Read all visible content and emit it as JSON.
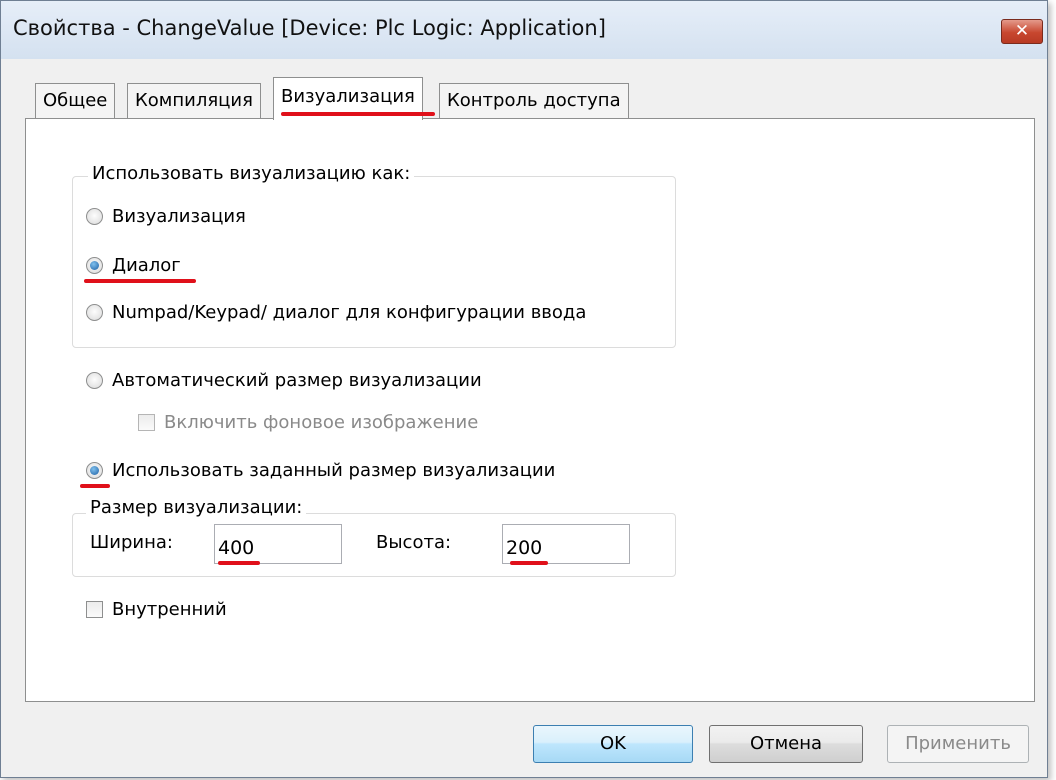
{
  "window": {
    "title": "Свойства - ChangeValue [Device: Plc Logic: Application]",
    "close_label": "✕"
  },
  "tabs": [
    {
      "label": "Общее",
      "active": false
    },
    {
      "label": "Компиляция",
      "active": false
    },
    {
      "label": "Визуализация",
      "active": true
    },
    {
      "label": "Контроль доступа",
      "active": false
    }
  ],
  "usage_group": {
    "legend": "Использовать визуализацию как:",
    "options": [
      {
        "label": "Визуализация",
        "checked": false
      },
      {
        "label": "Диалог",
        "checked": true
      },
      {
        "label": "Numpad/Keypad/ диалог для конфигурации ввода",
        "checked": false
      }
    ]
  },
  "size_mode": {
    "auto_label": "Автоматический размер визуализации",
    "auto_checked": false,
    "background_image_label": "Включить фоновое изображение",
    "background_image_checked": false,
    "fixed_label": "Использовать заданный размер визуализации",
    "fixed_checked": true
  },
  "size_group": {
    "legend": "Размер визуализации:",
    "width_label": "Ширина:",
    "width_value": "400",
    "height_label": "Высота:",
    "height_value": "200"
  },
  "internal": {
    "label": "Внутренний",
    "checked": false
  },
  "buttons": {
    "ok": "OK",
    "cancel": "Отмена",
    "apply": "Применить"
  },
  "colors": {
    "highlight_underline": "#e0101a",
    "radio_selected": "#1d5fa3",
    "close_button": "#c8472f"
  }
}
